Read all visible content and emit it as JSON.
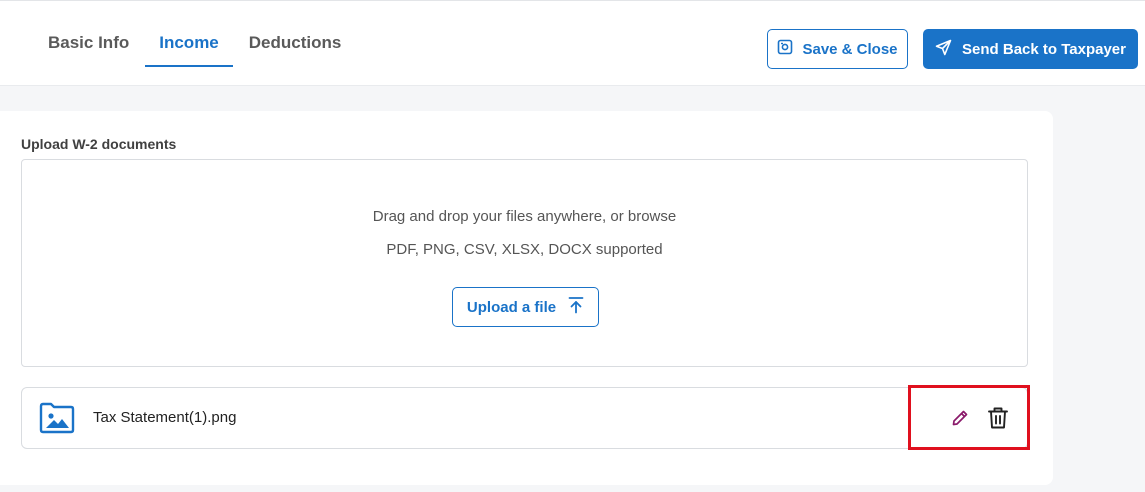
{
  "tabs": [
    {
      "label": "Basic Info",
      "active": false
    },
    {
      "label": "Income",
      "active": true
    },
    {
      "label": "Deductions",
      "active": false
    }
  ],
  "header": {
    "save_close_label": "Save & Close",
    "send_back_label": "Send Back to Taxpayer"
  },
  "upload": {
    "section_label": "Upload W-2 documents",
    "drag_text": "Drag and drop your files anywhere, or browse",
    "supported_text": "PDF, PNG, CSV, XLSX, DOCX supported",
    "upload_button_label": "Upload a file"
  },
  "files": [
    {
      "name": "Tax Statement(1).png"
    }
  ],
  "colors": {
    "accent": "#1a73c8",
    "edit_icon": "#8b1a6b",
    "highlight": "#e0101e"
  },
  "icons": {
    "save": "save-icon",
    "send": "send-icon",
    "upload": "upload-arrow-icon",
    "file": "image-folder-icon",
    "edit": "pencil-icon",
    "delete": "trash-icon"
  }
}
